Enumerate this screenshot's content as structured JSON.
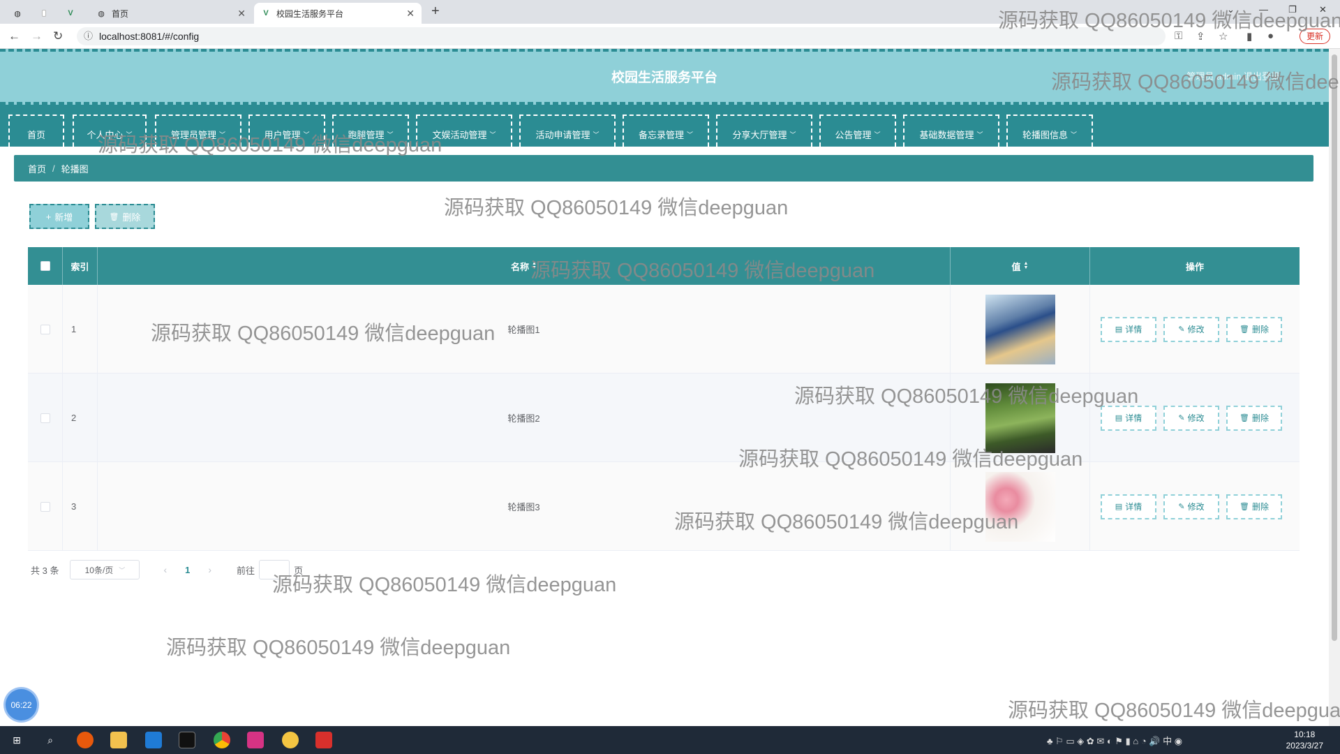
{
  "browser": {
    "tabs": [
      {
        "label": "",
        "active": false
      },
      {
        "label": "",
        "active": false
      },
      {
        "label": "",
        "active": false
      },
      {
        "label": "首页",
        "active": false
      },
      {
        "label": "校园生活服务平台",
        "active": true
      }
    ],
    "url": "localhost:8081/#/config",
    "update_label": "更新"
  },
  "app": {
    "title": "校园生活服务平台",
    "user_text": "管理员 admin  退出登录",
    "menu": [
      {
        "label": "首页",
        "dropdown": false
      },
      {
        "label": "个人中心",
        "dropdown": true
      },
      {
        "label": "管理员管理",
        "dropdown": true
      },
      {
        "label": "用户管理",
        "dropdown": true
      },
      {
        "label": "跑腿管理",
        "dropdown": true
      },
      {
        "label": "文娱活动管理",
        "dropdown": true
      },
      {
        "label": "活动申请管理",
        "dropdown": true
      },
      {
        "label": "备忘录管理",
        "dropdown": true
      },
      {
        "label": "分享大厅管理",
        "dropdown": true
      },
      {
        "label": "公告管理",
        "dropdown": true
      },
      {
        "label": "基础数据管理",
        "dropdown": true
      },
      {
        "label": "轮播图信息",
        "dropdown": true
      }
    ],
    "breadcrumb": [
      "首页",
      "轮播图"
    ],
    "buttons": {
      "add": "新增",
      "delete": "删除"
    },
    "table": {
      "headers": {
        "index": "索引",
        "name": "名称",
        "value": "值",
        "actions": "操作"
      },
      "rows": [
        {
          "index": "1",
          "name": "轮播图1",
          "image": "sailboat"
        },
        {
          "index": "2",
          "name": "轮播图2",
          "image": "park"
        },
        {
          "index": "3",
          "name": "轮播图3",
          "image": "flower"
        }
      ],
      "row_actions": {
        "detail": "详情",
        "edit": "修改",
        "delete": "删除"
      }
    },
    "pagination": {
      "total": "共 3 条",
      "page_size": "10条/页",
      "current_page": "1",
      "goto_label": "前往",
      "page_suffix": "页"
    }
  },
  "watermark_text": "源码获取 QQ86050149 微信deepguan",
  "clock_badge": "06:22",
  "taskbar": {
    "time": "10:18",
    "date": "2023/3/27"
  }
}
